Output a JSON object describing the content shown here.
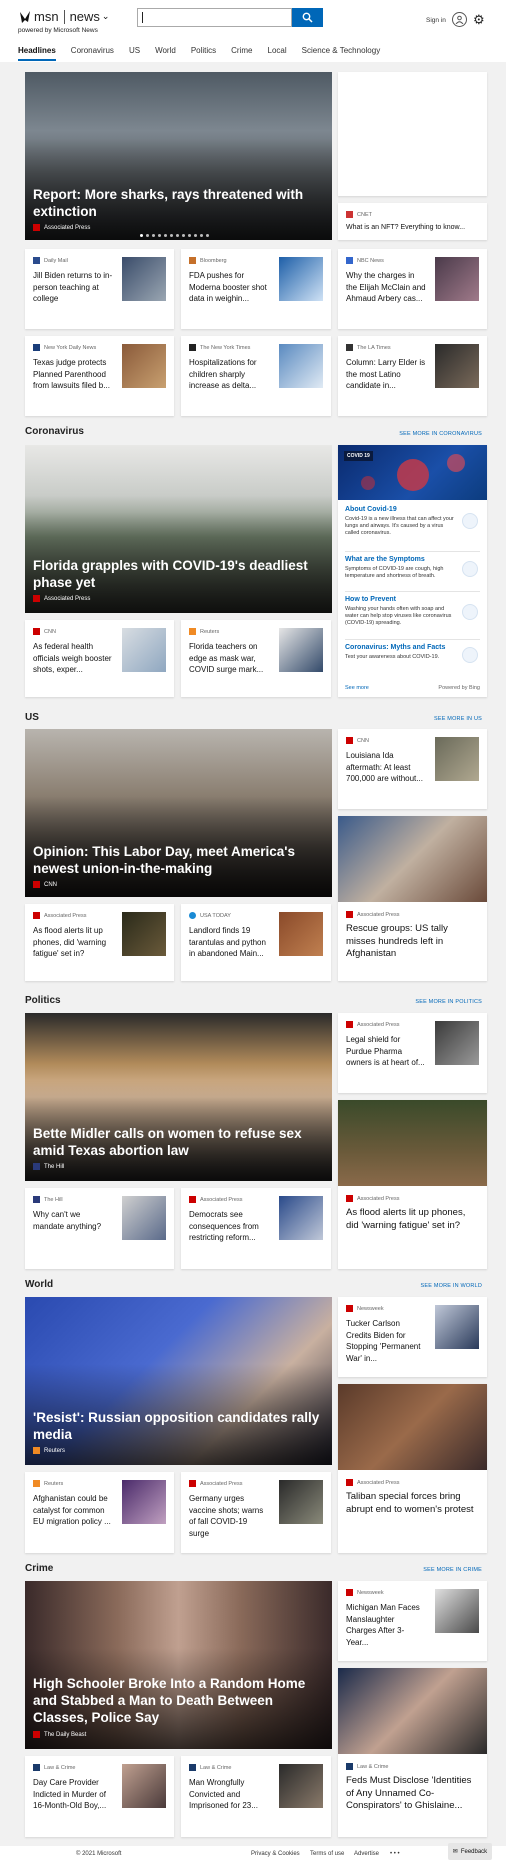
{
  "header": {
    "brand": "msn",
    "section": "news",
    "powered_by": "powered by Microsoft News",
    "search_placeholder": "",
    "sign_in": "Sign in",
    "icons": [
      "butterfly-icon",
      "search-icon",
      "user-icon",
      "gear-icon"
    ]
  },
  "nav": [
    "Headlines",
    "Coronavirus",
    "US",
    "World",
    "Politics",
    "Crime",
    "Local",
    "Science & Technology"
  ],
  "headlines": {
    "hero": {
      "title": "Report: More sharks, rays threatened with extinction",
      "source": "Associated Press"
    },
    "side_card": {
      "source": "CNET",
      "title": "What is an NFT? Everything to know..."
    },
    "cards": [
      {
        "source": "Daily Mail",
        "title": "Jill Biden returns to in-person teaching at college"
      },
      {
        "source": "Bloomberg",
        "title": "FDA pushes for Moderna booster shot data in weighin..."
      },
      {
        "source": "NBC News",
        "title": "Why the charges in the Elijah McClain and Ahmaud Arbery cas..."
      },
      {
        "source": "New York Daily News",
        "title": "Texas judge protects Planned Parenthood from lawsuits filed b..."
      },
      {
        "source": "The New York Times",
        "title": "Hospitalizations for children sharply increase as delta..."
      },
      {
        "source": "The LA Times",
        "title": "Column: Larry Elder is the most Latino candidate in..."
      }
    ]
  },
  "coronavirus": {
    "title": "Coronavirus",
    "see_more": "SEE MORE IN CORONAVIRUS",
    "hero": {
      "title": "Florida grapples with COVID-19's deadliest phase yet",
      "source": "Associated Press"
    },
    "cards": [
      {
        "source": "CNN",
        "title": "As federal health officials weigh booster shots, exper..."
      },
      {
        "source": "Reuters",
        "title": "Florida teachers on edge as mask war, COVID surge mark..."
      }
    ],
    "panel": {
      "tag": "COVID 19",
      "items": [
        {
          "title": "About Covid-19",
          "desc": "Covid-19 is a new illness that can affect your lungs and airways. It's caused by a virus called coronavirus."
        },
        {
          "title": "What are the Symptoms",
          "desc": "Symptoms of COVID-19 are cough, high temperature and shortness of breath."
        },
        {
          "title": "How to Prevent",
          "desc": "Washing your hands often with soap and water can help stop viruses like coronavirus (COVID-19) spreading."
        },
        {
          "title": "Coronavirus: Myths and Facts",
          "desc": "Test your awareness about COVID-19."
        }
      ],
      "see_more": "See more",
      "powered": "Powered by Bing"
    }
  },
  "us": {
    "title": "US",
    "see_more": "SEE MORE IN US",
    "hero": {
      "title": "Opinion: This Labor Day, meet America's newest union-in-the-making",
      "source": "CNN"
    },
    "side_card": {
      "source": "CNN",
      "title": "Louisiana Ida aftermath: At least 700,000 are without..."
    },
    "tall_card": {
      "source": "Associated Press",
      "title": "Rescue groups: US tally misses hundreds left in Afghanistan"
    },
    "cards": [
      {
        "source": "Associated Press",
        "title": "As flood alerts lit up phones, did 'warning fatigue' set in?"
      },
      {
        "source": "USA TODAY",
        "title": "Landlord finds 19 tarantulas and python in abandoned Main..."
      }
    ]
  },
  "politics": {
    "title": "Politics",
    "see_more": "SEE MORE IN POLITICS",
    "hero": {
      "title": "Bette Midler calls on women to refuse sex amid Texas abortion law",
      "source": "The Hill"
    },
    "side_card": {
      "source": "Associated Press",
      "title": "Legal shield for Purdue Pharma owners is at heart of..."
    },
    "tall_card": {
      "source": "Associated Press",
      "title": "As flood alerts lit up phones, did 'warning fatigue' set in?"
    },
    "cards": [
      {
        "source": "The Hill",
        "title": "Why can't we mandate anything?"
      },
      {
        "source": "Associated Press",
        "title": "Democrats see consequences from restricting reform..."
      }
    ]
  },
  "world": {
    "title": "World",
    "see_more": "SEE MORE IN WORLD",
    "hero": {
      "title": "'Resist': Russian opposition candidates rally media",
      "source": "Reuters"
    },
    "side_card": {
      "source": "Newsweek",
      "title": "Tucker Carlson Credits Biden for Stopping 'Permanent War' in..."
    },
    "tall_card": {
      "source": "Associated Press",
      "title": "Taliban special forces bring abrupt end to women's protest"
    },
    "cards": [
      {
        "source": "Reuters",
        "title": "Afghanistan could be catalyst for common EU migration policy ..."
      },
      {
        "source": "Associated Press",
        "title": "Germany urges vaccine shots; warns of fall COVID-19 surge"
      }
    ]
  },
  "crime": {
    "title": "Crime",
    "see_more": "SEE MORE IN CRIME",
    "hero": {
      "title": "High Schooler Broke Into a Random Home and Stabbed a Man to Death Between Classes, Police Say",
      "source": "The Daily Beast"
    },
    "side_card": {
      "source": "Newsweek",
      "title": "Michigan Man Faces Manslaughter Charges After 3-Year..."
    },
    "tall_card": {
      "source": "Law & Crime",
      "title": "Feds Must Disclose 'Identities of Any Unnamed Co-Conspirators' to Ghislaine..."
    },
    "cards": [
      {
        "source": "Law & Crime",
        "title": "Day Care Provider Indicted in Murder of 16-Month-Old Boy,..."
      },
      {
        "source": "Law & Crime",
        "title": "Man Wrongfully Convicted and Imprisoned for 23..."
      }
    ]
  },
  "footer": {
    "copyright": "© 2021 Microsoft",
    "links": [
      "Privacy & Cookies",
      "Terms of use",
      "Advertise"
    ],
    "more": "• • •",
    "feedback": "Feedback"
  },
  "colors": {
    "accent": "#0067b8",
    "page_bg": "#f1f1f1"
  }
}
